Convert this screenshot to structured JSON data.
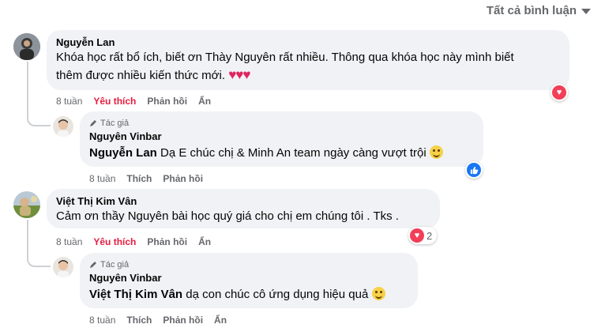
{
  "sort": {
    "label": "Tất cả bình luận",
    "icon": "caret-down-icon"
  },
  "comments": [
    {
      "name": "Nguyễn Lan",
      "line1": "Khóa học rất bổ ích, biết ơn Thày Nguyên rất nhiều. Thông qua khóa học này mình biết",
      "line2": "thêm được nhiều kiến thức mới.",
      "hearts": "♥♥♥",
      "time": "8 tuần",
      "like": "Yêu thích",
      "reply": "Phản hồi",
      "hide": "Ẩn",
      "reaction": {
        "icon": "heart-reaction-icon",
        "color": "#f33e58"
      },
      "replies": [
        {
          "author_tag": "Tác giả",
          "name": "Nguyên Vinbar",
          "mention": "Nguyễn Lan",
          "text": "Dạ E chúc chị & Minh An team ngày càng vượt trội",
          "time": "8 tuần",
          "like": "Thích",
          "reply": "Phản hồi",
          "reaction": {
            "icon": "like-reaction-icon",
            "color": "#1877f2"
          }
        }
      ]
    },
    {
      "name": "Việt Thị Kim Vân",
      "text": "Cảm ơn thầy Nguyên bài học quý giá cho chị em chúng tôi . Tks .",
      "time": "8 tuần",
      "like": "Yêu thích",
      "reply": "Phản hồi",
      "hide": "Ẩn",
      "reaction": {
        "icon": "heart-reaction-icon",
        "color": "#f33e58",
        "count": "2"
      },
      "replies": [
        {
          "author_tag": "Tác giả",
          "name": "Nguyên Vinbar",
          "mention": "Việt Thị Kim Vân",
          "text": "dạ con chúc cô ứng dụng hiệu quả",
          "time": "8 tuần",
          "like": "Thích",
          "reply": "Phản hồi",
          "hide": "Ẩn"
        }
      ]
    }
  ]
}
